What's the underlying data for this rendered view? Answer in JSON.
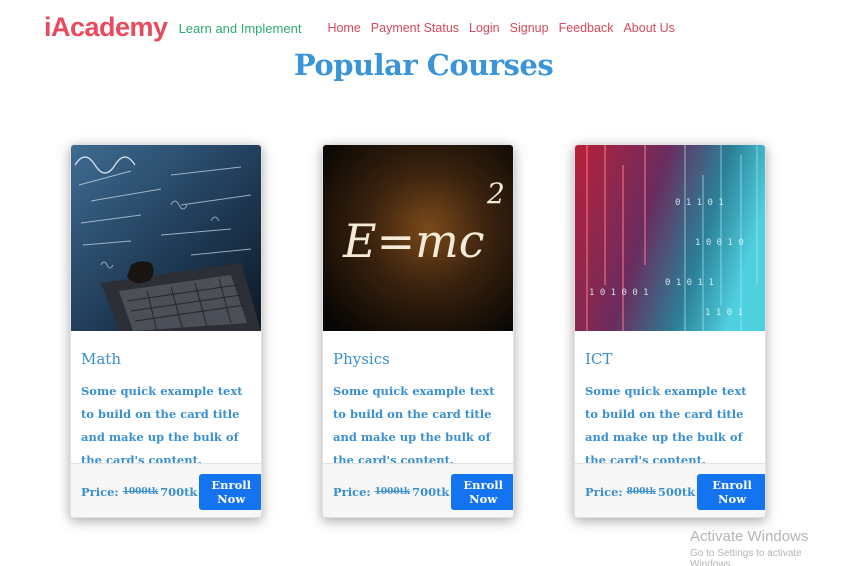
{
  "header": {
    "brand": "iAcademy",
    "tagline": "Learn and Implement",
    "nav": [
      "Home",
      "Payment Status",
      "Login",
      "Signup",
      "Feedback",
      "About Us"
    ]
  },
  "page": {
    "title": "Popular Courses"
  },
  "courses": [
    {
      "title": "Math",
      "text": "Some quick example text to build on the card title and make up the bulk of the card's content.",
      "price_label": "Price:",
      "price_old": "1000tk",
      "price_new": "700tk",
      "button": "Enroll Now",
      "image": "math-formulas-laptop"
    },
    {
      "title": "Physics",
      "text": "Some quick example text to build on the card title and make up the bulk of the card's content.",
      "price_label": "Price:",
      "price_old": "1000tk",
      "price_new": "700tk",
      "button": "Enroll Now",
      "image": "emc2-chalkboard",
      "image_text": "E=mc",
      "image_text_sup": "2"
    },
    {
      "title": "ICT",
      "text": "Some quick example text to build on the card title and make up the bulk of the card's content.",
      "price_label": "Price:",
      "price_old": "800tk",
      "price_new": "500tk",
      "button": "Enroll Now",
      "image": "digital-binary-code"
    }
  ],
  "watermark": {
    "title": "Activate Windows",
    "subtitle": "Go to Settings to activate Windows."
  },
  "colors": {
    "brand": "#e74c5e",
    "tagline": "#2eaa75",
    "nav": "#d64a5a",
    "title": "#3a95d8",
    "card_text": "#3a8fd0",
    "button": "#1373f0"
  }
}
